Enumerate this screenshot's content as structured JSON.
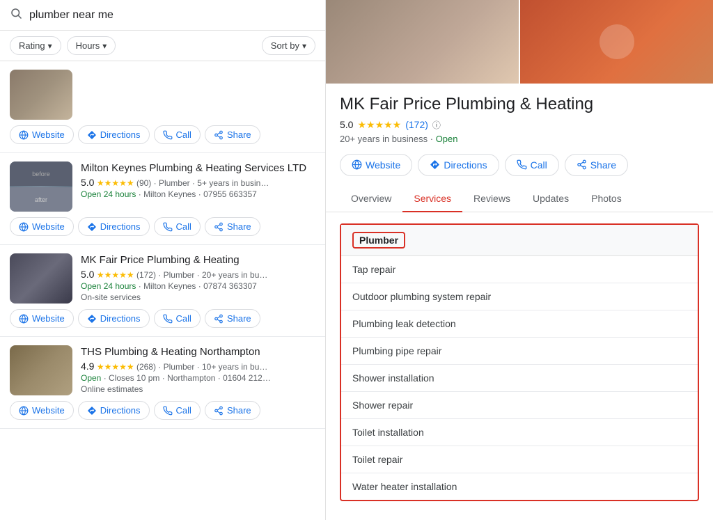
{
  "search": {
    "placeholder": "plumber near me",
    "value": "plumber near me"
  },
  "filters": {
    "rating_label": "Rating",
    "hours_label": "Hours",
    "sort_label": "Sort by"
  },
  "results": [
    {
      "id": "result-1",
      "thumb_class": "thumb1",
      "name": "",
      "meta": "",
      "open_text": "",
      "extra": ""
    },
    {
      "id": "result-2",
      "thumb_class": "thumb2",
      "name": "Milton Keynes Plumbing & Heating Services LTD",
      "rating": "5.0",
      "stars": "★★★★★",
      "reviews": "(90)",
      "meta": " · Plumber · 5+ years in busin…",
      "open_text": "Open 24 hours",
      "location_phone": " · Milton Keynes · 07955 663357",
      "extra": ""
    },
    {
      "id": "result-3",
      "thumb_class": "thumb3",
      "name": "MK Fair Price Plumbing & Heating",
      "rating": "5.0",
      "stars": "★★★★★",
      "reviews": "(172)",
      "meta": " · Plumber · 20+ years in bu…",
      "open_text": "Open 24 hours",
      "location_phone": " · Milton Keynes · 07874 363307",
      "extra": "On-site services"
    },
    {
      "id": "result-4",
      "thumb_class": "thumb4",
      "name": "THS Plumbing & Heating Northampton",
      "rating": "4.9",
      "stars": "★★★★★",
      "reviews": "(268)",
      "meta": " · Plumber · 10+ years in bu…",
      "open_text": "Open",
      "location_phone": " · Closes 10 pm · Northampton · 01604 212…",
      "extra": "Online estimates"
    }
  ],
  "action_buttons": {
    "website": "Website",
    "directions": "Directions",
    "call": "Call",
    "share": "Share"
  },
  "detail": {
    "business_name": "MK Fair Price Plumbing & Heating",
    "rating": "5.0",
    "stars": "★★★★★",
    "review_count": "(172)",
    "years": "20+ years in business",
    "open_status": "Open",
    "website_btn": "Website",
    "directions_btn": "Directions",
    "call_btn": "Call",
    "share_btn": "Share"
  },
  "tabs": [
    {
      "id": "overview",
      "label": "Overview",
      "active": false
    },
    {
      "id": "services",
      "label": "Services",
      "active": true
    },
    {
      "id": "reviews",
      "label": "Reviews",
      "active": false
    },
    {
      "id": "updates",
      "label": "Updates",
      "active": false
    },
    {
      "id": "photos",
      "label": "Photos",
      "active": false
    }
  ],
  "services": {
    "category": "Plumber",
    "items": [
      "Tap repair",
      "Outdoor plumbing system repair",
      "Plumbing leak detection",
      "Plumbing pipe repair",
      "Shower installation",
      "Shower repair",
      "Toilet installation",
      "Toilet repair",
      "Water heater installation"
    ]
  }
}
